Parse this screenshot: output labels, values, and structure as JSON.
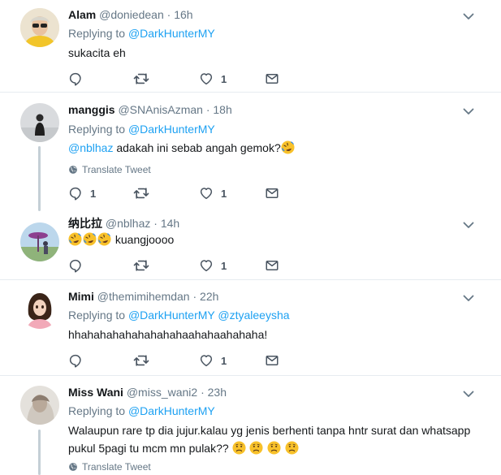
{
  "tweets": [
    {
      "name": "Alam",
      "handle": "@doniedean",
      "dot": "·",
      "time": "16h",
      "replying_label": "Replying to",
      "replying_to": [
        "@DarkHunterMY"
      ],
      "text": "sukacita eh",
      "reply_count": "",
      "retweet_count": "",
      "like_count": "1"
    },
    {
      "name": "manggis",
      "handle": "@SNAnisAzman",
      "dot": "·",
      "time": "18h",
      "replying_label": "Replying to",
      "replying_to": [
        "@DarkHunterMY"
      ],
      "mention": "@nblhaz",
      "text": " adakah ini sebab angah gemok?",
      "translate": "Translate Tweet",
      "reply_count": "1",
      "retweet_count": "",
      "like_count": "1"
    },
    {
      "name": "纳比拉",
      "handle": "@nblhaz",
      "dot": "·",
      "time": "14h",
      "text": " kuangjoooo",
      "reply_count": "",
      "retweet_count": "",
      "like_count": "1"
    },
    {
      "name": "Mimi",
      "handle": "@themimihemdan",
      "dot": "·",
      "time": "22h",
      "replying_label": "Replying to",
      "replying_to": [
        "@DarkHunterMY",
        "@ztyaleeysha"
      ],
      "text": "hhahahahahahahahahaahahaahahaha!",
      "reply_count": "",
      "retweet_count": "",
      "like_count": "1"
    },
    {
      "name": "Miss Wani",
      "handle": "@miss_wani2",
      "dot": "·",
      "time": "23h",
      "replying_label": "Replying to",
      "replying_to": [
        "@DarkHunterMY"
      ],
      "text_line1": "Walaupun rare tp dia jujur.kalau yg jenis berhenti tanpa hntr surat dan  whatsapp",
      "text_line2": "pukul 5pagi tu mcm mn pulak?? ",
      "translate": "Translate Tweet"
    }
  ],
  "icons": {
    "reply": "reply-icon",
    "retweet": "retweet-icon",
    "like": "heart-icon",
    "dm": "envelope-icon",
    "more": "chevron-down-icon",
    "globe": "globe-icon"
  },
  "colors": {
    "link": "#1da1f2",
    "secondary": "#657786",
    "divider": "#e6ecf0",
    "thread": "#c4cfd6"
  }
}
